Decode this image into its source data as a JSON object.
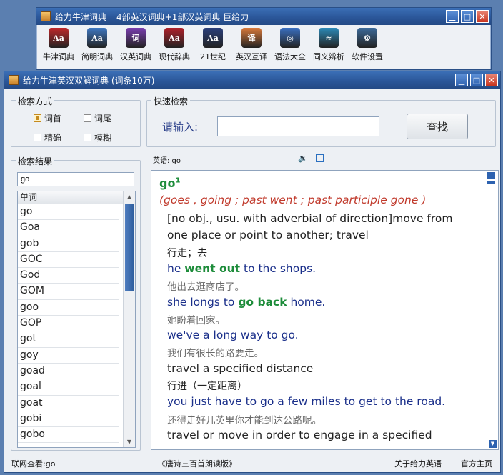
{
  "top_window": {
    "title": "给力牛津词典",
    "subtitle": "4部英汉词典+1部汉英词典  巨给力",
    "buttons": {
      "min": "▁",
      "max": "□",
      "close": "✕"
    },
    "toolbar": [
      {
        "label": "牛津词典",
        "icon": "oxford-book-icon",
        "color": "#c0282a"
      },
      {
        "label": "简明词典",
        "icon": "concise-dict-icon",
        "color": "#3f78c2"
      },
      {
        "label": "汉英词典",
        "icon": "chinese-english-icon",
        "color": "#7a3fb0"
      },
      {
        "label": "现代辞典",
        "icon": "modern-dict-icon",
        "color": "#b0212a"
      },
      {
        "label": "21世纪",
        "icon": "century21-icon",
        "color": "#2a3f7a"
      },
      {
        "label": "英汉互译",
        "icon": "translate-icon",
        "color": "#d9793a"
      },
      {
        "label": "语法大全",
        "icon": "grammar-compass-icon",
        "color": "#3a6fc0"
      },
      {
        "label": "同义辨析",
        "icon": "synonym-icon",
        "color": "#2c8ab8"
      },
      {
        "label": "软件设置",
        "icon": "gear-icon",
        "color": "#3c6a9a"
      }
    ],
    "toolbar_glyphs": [
      "Aa",
      "Aa",
      "词",
      "Aa",
      "Aa",
      "译",
      "◎",
      "≈",
      "⚙"
    ]
  },
  "main_window": {
    "title": "给力牛津英汉双解词典  (词条10万)",
    "search_mode": {
      "label": "检索方式",
      "options": [
        {
          "label": "词首",
          "checked": true
        },
        {
          "label": "词尾",
          "checked": false
        },
        {
          "label": "精确",
          "checked": false
        },
        {
          "label": "模糊",
          "checked": false
        }
      ]
    },
    "quick_search": {
      "label": "快速检索",
      "prompt": "请输入:",
      "value": "",
      "button": "查找"
    },
    "results": {
      "label": "检索结果",
      "query": "go",
      "column": "单词",
      "words": [
        "go",
        "Goa",
        "gob",
        "GOC",
        "God",
        "GOM",
        "goo",
        "GOP",
        "got",
        "goy",
        "goad",
        "goal",
        "goat",
        "gobi",
        "gobo"
      ]
    },
    "definition": {
      "label": "英语: go",
      "headword": "go",
      "sup": "1",
      "forms": "(goes , going ; past went ; past participle gone )",
      "lines": [
        {
          "type": "def",
          "text": "[no obj., usu. with adverbial of direction]move from"
        },
        {
          "type": "def",
          "text": "one place or point to another; travel"
        },
        {
          "type": "cn_def",
          "text": "行走；去"
        },
        {
          "type": "ex",
          "pre": "he ",
          "hl": "went out",
          "post": " to the shops."
        },
        {
          "type": "cn",
          "text": "他出去逛商店了。"
        },
        {
          "type": "ex",
          "pre": "she longs to ",
          "hl": "go back",
          "post": " home."
        },
        {
          "type": "cn",
          "text": "她盼着回家。"
        },
        {
          "type": "ex",
          "pre": "we've a long way to go.",
          "hl": "",
          "post": ""
        },
        {
          "type": "cn",
          "text": "我们有很长的路要走。"
        },
        {
          "type": "def",
          "text": "travel a specified distance"
        },
        {
          "type": "cn_def",
          "text": "行进（一定距离）"
        },
        {
          "type": "ex",
          "pre": "you just have to go a few miles to get to the road.",
          "hl": "",
          "post": ""
        },
        {
          "type": "cn",
          "text": "还得走好几英里你才能到达公路呢。"
        },
        {
          "type": "def",
          "text": "travel or move in order to engage in a specified"
        }
      ]
    },
    "status": {
      "online": "联网查看:go",
      "promo": "《唐诗三百首朗读版》",
      "about": "关于给力英语",
      "home": "官方主页"
    },
    "buttons": {
      "min": "▁",
      "max": "□",
      "close": "✕"
    }
  }
}
